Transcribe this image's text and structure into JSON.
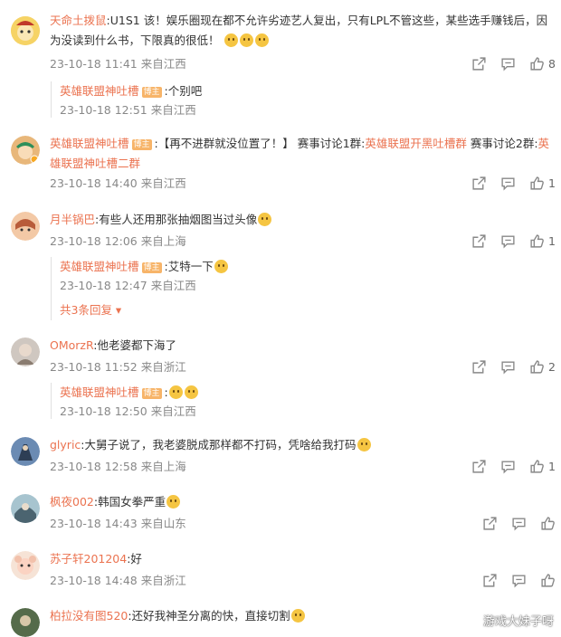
{
  "comments": [
    {
      "user": "天命土拨鼠",
      "text": ":U1S1 该！娱乐圈现在都不允许劣迹艺人复出，只有LPL不管这些，某些选手赚钱后，因为没读到什么书，下限真的很低！",
      "time": "23-10-18 11:41",
      "location": "来自江西",
      "likes": "8",
      "reply": {
        "user": "英雄联盟神吐槽",
        "badge": "博主",
        "text": ":个别吧",
        "time": "23-10-18 12:51",
        "location": "来自江西"
      }
    },
    {
      "user": "英雄联盟神吐槽",
      "badge": "博主",
      "text_a": ":【再不进群就没位置了！】 赛事讨论1群:",
      "link1": "英雄联盟开黑吐槽群",
      "text_b": " 赛事讨论2群:",
      "link2": "英雄联盟神吐槽二群",
      "time": "23-10-18 14:40",
      "location": "来自江西",
      "likes": "1"
    },
    {
      "user": "月半锅巴",
      "text": ":有些人还用那张抽烟图当过头像",
      "time": "23-10-18 12:06",
      "location": "来自上海",
      "likes": "1",
      "reply": {
        "user": "英雄联盟神吐槽",
        "badge": "博主",
        "text": ":艾特一下",
        "time": "23-10-18 12:47",
        "location": "来自江西"
      },
      "more_replies": "共3条回复"
    },
    {
      "user": "OMorzR",
      "text": ":他老婆都下海了",
      "time": "23-10-18 11:52",
      "location": "来自浙江",
      "likes": "2",
      "reply": {
        "user": "英雄联盟神吐槽",
        "badge": "博主",
        "text": ":",
        "time": "23-10-18 12:50",
        "location": "来自江西"
      }
    },
    {
      "user": "glyric",
      "text": ":大舅子说了，我老婆脱成那样都不打码，凭啥给我打码",
      "time": "23-10-18 12:58",
      "location": "来自上海",
      "likes": "1"
    },
    {
      "user": "枫夜002",
      "text": ":韩国女拳严重",
      "time": "23-10-18 14:43",
      "location": "来自山东",
      "likes": ""
    },
    {
      "user": "苏子轩201204",
      "text": ":好",
      "time": "23-10-18 14:48",
      "location": "来自浙江",
      "likes": ""
    },
    {
      "user": "柏拉没有图520",
      "text": ":还好我神圣分离的快，直接切割",
      "time": "",
      "location": "",
      "likes": ""
    }
  ],
  "watermark": "游戏大妹子呀",
  "colors": {
    "username": "#eb7350",
    "meta": "#888888",
    "badge": "#f7b469"
  },
  "icons": [
    "share-icon",
    "comment-icon",
    "like-icon"
  ]
}
